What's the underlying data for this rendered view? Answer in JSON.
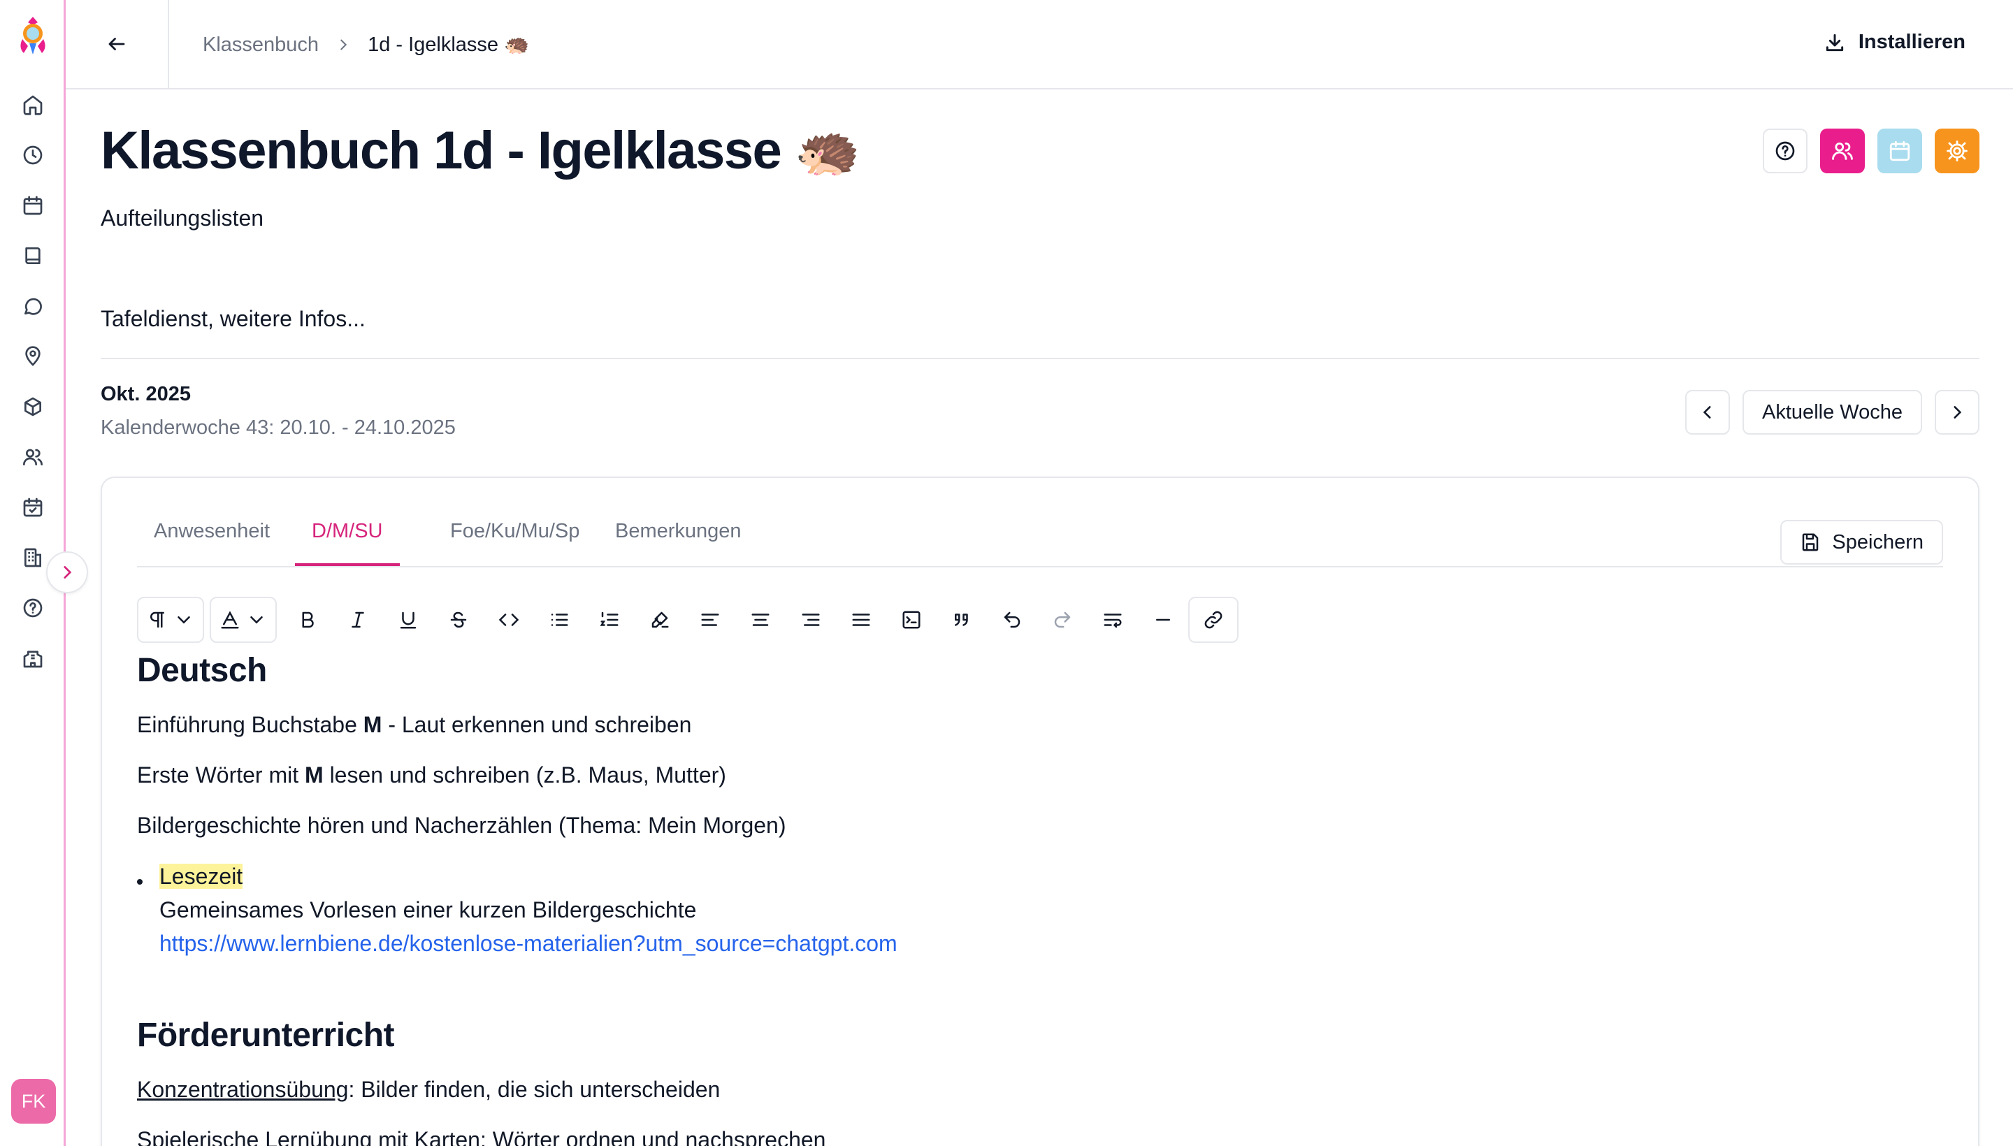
{
  "app": {
    "avatar_initials": "FK"
  },
  "topbar": {
    "breadcrumb_root": "Klassenbuch",
    "breadcrumb_current": "1d - Igelklasse 🦔",
    "install_label": "Installieren"
  },
  "header": {
    "title": "Klassenbuch 1d - Igelklasse 🦔",
    "subtitle": "Aufteilungslisten",
    "info": "Tafeldienst, weitere Infos..."
  },
  "week": {
    "month": "Okt. 2025",
    "range": "Kalenderwoche 43: 20.10. - 24.10.2025",
    "current_week_label": "Aktuelle Woche"
  },
  "tabs": [
    {
      "label": "Anwesenheit",
      "active": false
    },
    {
      "label": "D/M/SU",
      "active": true
    },
    {
      "label": "Foe/Ku/Mu/Sp",
      "active": false
    },
    {
      "label": "Bemerkungen",
      "active": false
    }
  ],
  "save_label": "Speichern",
  "toolbar_icons": [
    "paragraph-icon",
    "text-color-icon",
    "bold-icon",
    "italic-icon",
    "underline-icon",
    "strikethrough-icon",
    "code-icon",
    "bullet-list-icon",
    "ordered-list-icon",
    "highlighter-icon",
    "align-left-icon",
    "align-center-icon",
    "align-right-icon",
    "align-justify-icon",
    "code-block-icon",
    "quote-icon",
    "undo-icon",
    "redo-icon",
    "wrap-icon",
    "horizontal-rule-icon",
    "link-icon"
  ],
  "editor": {
    "section1_heading": "Deutsch",
    "line1_pre": "Einführung Buchstabe ",
    "line1_bold": "M",
    "line1_post": " - Laut erkennen und schreiben",
    "line2_pre": "Erste Wörter mit ",
    "line2_bold": "M",
    "line2_post": " lesen und schreiben (z.B. Maus, Mutter)",
    "line3": "Bildergeschichte hören und Nacherzählen (Thema: Mein Morgen)",
    "bullet_highlight": "Lesezeit",
    "bullet_text": "Gemeinsames Vorlesen einer kurzen Bildergeschichte",
    "bullet_link": "https://www.lernbiene.de/kostenlose-materialien?utm_source=chatgpt.com",
    "section2_heading": "Förderunterricht",
    "line4_underline": "Konzentrationsübung",
    "line4_post": ": Bilder finden, die sich unterscheiden",
    "line5": "Spielerische Lernübung mit Karten: Wörter ordnen und nachsprechen"
  },
  "colors": {
    "accent_pink": "#d6247b",
    "users_button": "#e91e8c",
    "calendar_button": "#a8dcee",
    "settings_button": "#f7941d",
    "highlight": "#fdf39a",
    "link": "#2563eb",
    "sidebar_border": "#f4a6d7"
  }
}
